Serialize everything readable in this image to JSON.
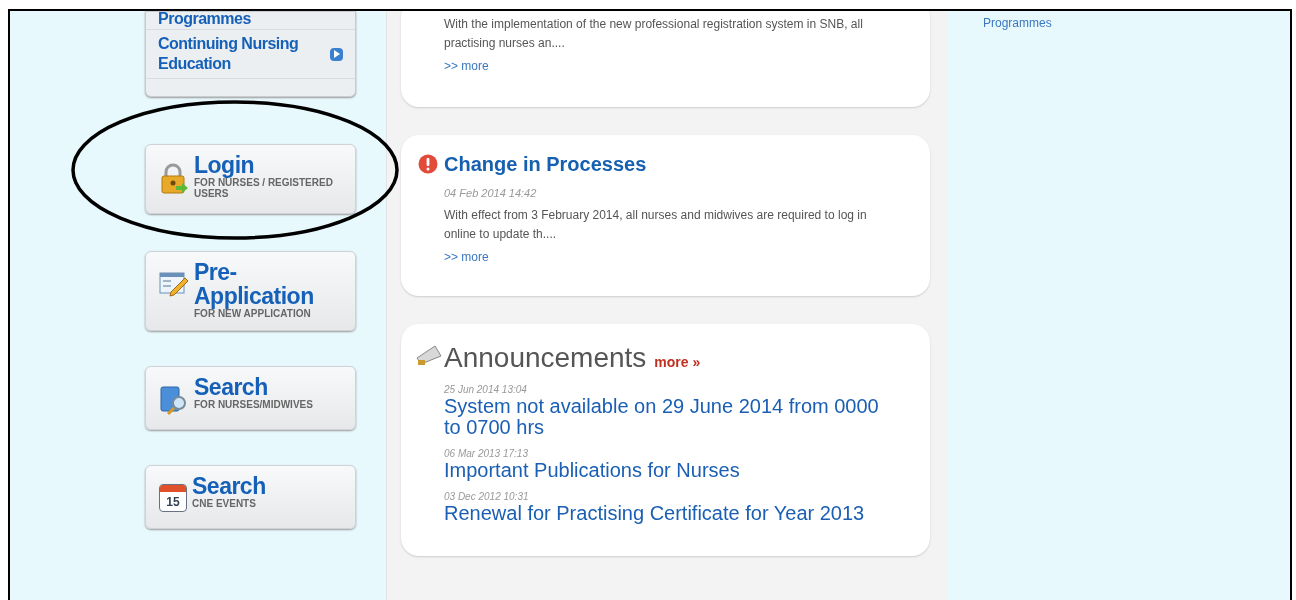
{
  "left_menu": {
    "items": [
      {
        "label": "Programmes",
        "arrow": false
      },
      {
        "label": "Continuing Nursing Education",
        "arrow": true
      }
    ]
  },
  "quick_links": [
    {
      "kind": "login",
      "title": "Login",
      "subtitle": "FOR NURSES / REGISTERED USERS"
    },
    {
      "kind": "application",
      "title": "Pre-Application",
      "subtitle": "FOR NEW APPLICATION"
    },
    {
      "kind": "search",
      "title": "Search",
      "subtitle": "FOR NURSES/MIDWIVES"
    },
    {
      "kind": "calendar",
      "title": "Search",
      "subtitle": "CNE EVENTS",
      "day": "15"
    }
  ],
  "news": [
    {
      "body": "With the implementation of the new professional registration system in SNB, all practising nurses an....",
      "more": ">> more"
    },
    {
      "alert": true,
      "title": "Change in Processes",
      "date": "04 Feb 2014 14:42",
      "body": "With effect from 3 February 2014, all nurses and midwives are required to log in online to update th....",
      "more": ">> more"
    }
  ],
  "announcements": {
    "title": "Announcements",
    "more": "more »",
    "items": [
      {
        "date": "25 Jun 2014 13:04",
        "title": "System not available on 29 June 2014 from 0000 to 0700 hrs"
      },
      {
        "date": "06 Mar 2013 17:13",
        "title": "Important Publications for Nurses"
      },
      {
        "date": "03 Dec 2012 10:31",
        "title": "Renewal for Practising Certificate for Year 2013"
      }
    ]
  },
  "right_links": [
    "Programmes"
  ]
}
